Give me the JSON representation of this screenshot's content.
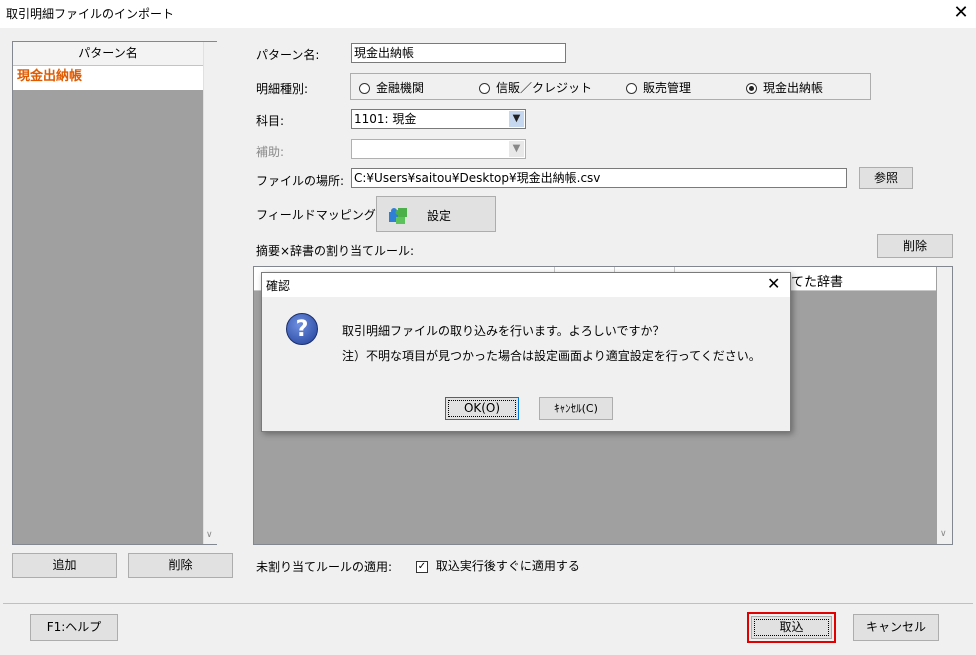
{
  "window": {
    "title": "取引明細ファイルのインポート",
    "close": "✕"
  },
  "pattern_list": {
    "header": "パターン名",
    "selected": "現金出納帳"
  },
  "left_buttons": {
    "add": "追加",
    "delete": "削除"
  },
  "form": {
    "pattern_name_label": "パターン名:",
    "pattern_name_value": "現金出納帳",
    "detail_type_label": "明細種別:",
    "radios": [
      {
        "label": "金融機関",
        "selected": false
      },
      {
        "label": "信販／クレジット",
        "selected": false
      },
      {
        "label": "販売管理",
        "selected": false
      },
      {
        "label": "現金出納帳",
        "selected": true
      }
    ],
    "account_label": "科目:",
    "account_value": "1101: 現金",
    "sub_label": "補助:",
    "sub_value": "",
    "file_location_label": "ファイルの場所:",
    "file_location_value": "C:¥Users¥saitou¥Desktop¥現金出納帳.csv",
    "browse_button": "参照",
    "field_mapping_label": "フィールドマッピング:",
    "settings_button": "設定",
    "rule_label": "摘要×辞書の割り当てルール:",
    "rule_delete_button": "削除",
    "grid_col_fragment": "てた辞書",
    "unassigned_label": "未割り当てルールの適用:",
    "apply_checkbox_label": "取込実行後すぐに適用する",
    "apply_checked": true
  },
  "dialog": {
    "title": "確認",
    "message": "取引明細ファイルの取り込みを行います。よろしいですか？",
    "note": "注）不明な項目が見つかった場合は設定画面より適宜設定を行ってください。",
    "ok": "OK(O)",
    "cancel": "ｷｬﾝｾﾙ(C)"
  },
  "footer": {
    "help": "F1:ヘルプ",
    "import": "取込",
    "cancel": "キャンセル"
  }
}
